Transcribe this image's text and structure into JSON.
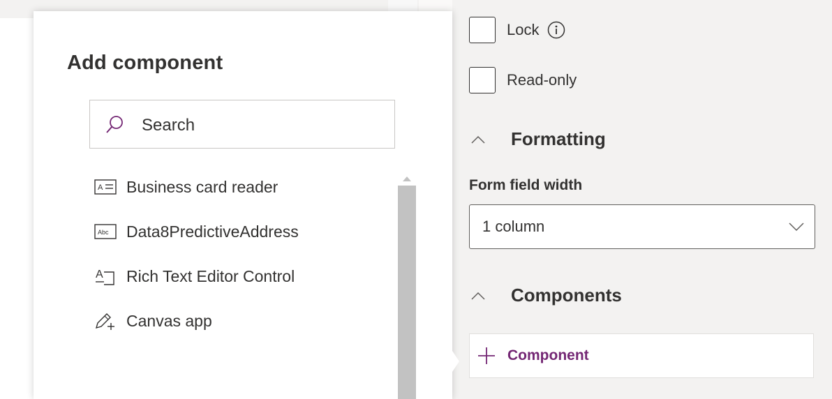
{
  "flyout": {
    "title": "Add component",
    "search": {
      "placeholder": "Search",
      "icon": "search-icon"
    },
    "items": [
      {
        "label": "Business card reader",
        "icon": "contact-card-icon"
      },
      {
        "label": "Data8PredictiveAddress",
        "icon": "text-field-icon"
      },
      {
        "label": "Rich Text Editor Control",
        "icon": "rich-text-icon"
      },
      {
        "label": "Canvas app",
        "icon": "canvas-pen-icon"
      }
    ]
  },
  "properties": {
    "lock_label": "Lock",
    "read_only_label": "Read-only",
    "formatting": {
      "title": "Formatting",
      "form_field_width_label": "Form field width",
      "form_field_width_value": "1 column"
    },
    "components": {
      "title": "Components",
      "add_label": "Component"
    }
  },
  "colors": {
    "accent": "#742774",
    "panel_bg": "#f3f2f1",
    "text": "#323130",
    "scrollbar": "#c2c2c2"
  }
}
